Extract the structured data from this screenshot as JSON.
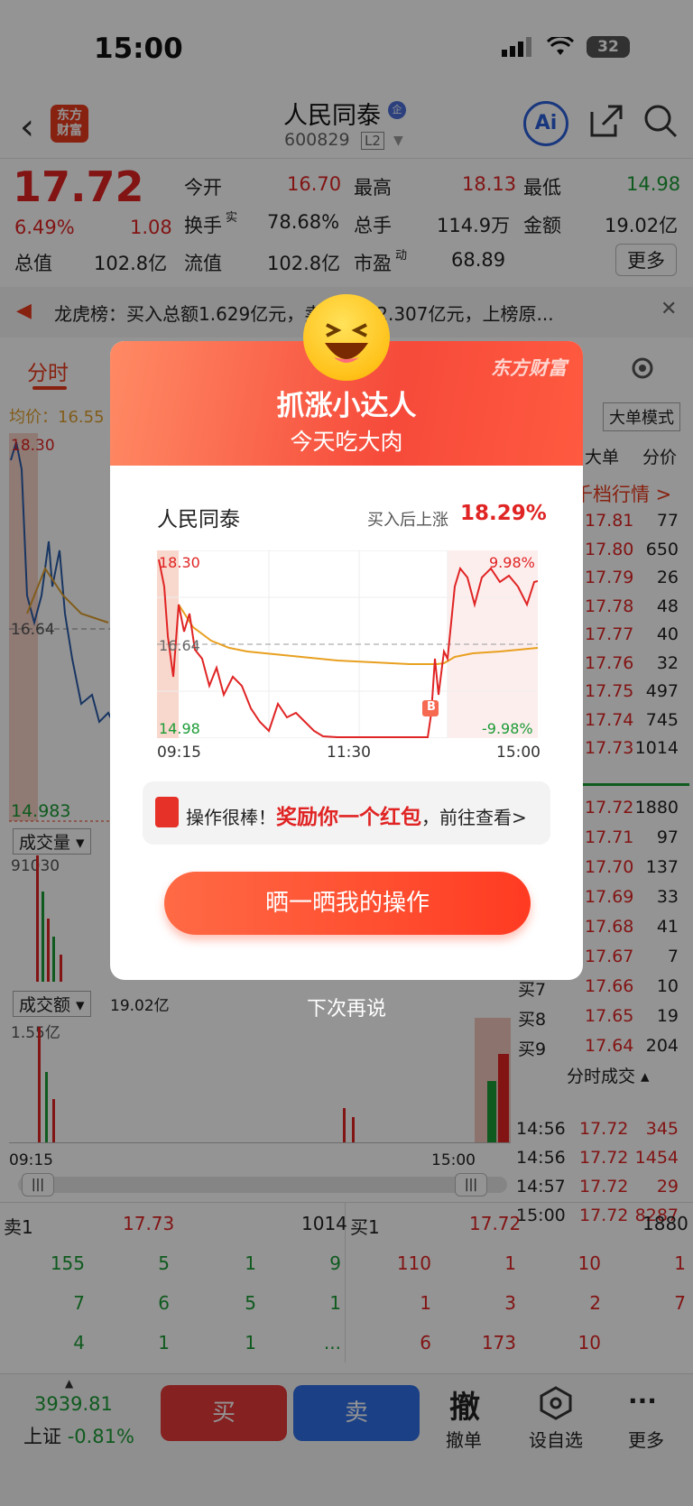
{
  "status": {
    "time": "15:00",
    "battery": "32"
  },
  "header": {
    "stock_name": "人民同泰",
    "badge": "企",
    "stock_code": "600829",
    "level": "L2",
    "logo_line1": "东方",
    "logo_line2": "财富",
    "ai_label": "Ai"
  },
  "quote": {
    "price": "17.72",
    "change_pct": "6.49%",
    "change": "1.08",
    "open_label": "今开",
    "open": "16.70",
    "high_label": "最高",
    "high": "18.13",
    "low_label": "最低",
    "low": "14.98",
    "turnover_label": "换手",
    "turnover_sup": "实",
    "turnover": "78.68%",
    "vol_label": "总手",
    "vol": "114.9万",
    "amount_label": "金额",
    "amount": "19.02亿",
    "mcap_label": "总值",
    "mcap": "102.8亿",
    "float_label": "流值",
    "float": "102.8亿",
    "pe_label": "市盈",
    "pe_sup": "动",
    "pe": "68.89",
    "more": "更多"
  },
  "news": {
    "text": "龙虎榜：买入总额1.629亿元，卖出总额2.307亿元，上榜原..."
  },
  "tabs": {
    "active": "分时",
    "mode": "大单模式"
  },
  "chart": {
    "avg_label": "均价：16.55",
    "high": "18.30",
    "mid": "16.64",
    "low": "14.983",
    "vol_selector": "成交量",
    "vol_max": "91030",
    "amt_selector": "成交额",
    "amt_total": "19.02亿",
    "amt_max": "1.55亿",
    "x_start": "09:15",
    "x_end": "15:00"
  },
  "right_col": {
    "h_big": "大单",
    "h_price": "分价",
    "title": "千档行情 >",
    "sells": [
      {
        "price": "17.81",
        "vol": "77"
      },
      {
        "price": "17.80",
        "vol": "650"
      },
      {
        "price": "17.79",
        "vol": "26"
      },
      {
        "price": "17.78",
        "vol": "48"
      },
      {
        "price": "17.77",
        "vol": "40"
      },
      {
        "price": "17.76",
        "vol": "32"
      },
      {
        "price": "17.75",
        "vol": "497"
      },
      {
        "price": "17.74",
        "vol": "745"
      },
      {
        "price": "17.73",
        "vol": "1014"
      }
    ],
    "buys": [
      {
        "label": "",
        "price": "17.72",
        "vol": "1880"
      },
      {
        "label": "",
        "price": "17.71",
        "vol": "97"
      },
      {
        "label": "",
        "price": "17.70",
        "vol": "137"
      },
      {
        "label": "",
        "price": "17.69",
        "vol": "33"
      },
      {
        "label": "",
        "price": "17.68",
        "vol": "41"
      },
      {
        "label": "",
        "price": "17.67",
        "vol": "7"
      },
      {
        "label": "买7",
        "price": "17.66",
        "vol": "10"
      },
      {
        "label": "买8",
        "price": "17.65",
        "vol": "19"
      },
      {
        "label": "买9",
        "price": "17.64",
        "vol": "204"
      }
    ],
    "ticks_title": "分时成交",
    "ticks": [
      {
        "time": "14:56",
        "price": "17.72",
        "vol": "345"
      },
      {
        "time": "14:56",
        "price": "17.72",
        "vol": "1454"
      },
      {
        "time": "14:57",
        "price": "17.72",
        "vol": "29"
      },
      {
        "time": "15:00",
        "price": "17.72",
        "vol": "8287"
      }
    ]
  },
  "bottom_book": {
    "sell1_label": "卖1",
    "sell1_price": "17.73",
    "sell1_vol": "1014",
    "buy1_label": "买1",
    "buy1_price": "17.72",
    "buy1_vol": "1880",
    "sell_rows": [
      [
        "155",
        "5",
        "1",
        "9"
      ],
      [
        "7",
        "6",
        "5",
        "1"
      ],
      [
        "4",
        "1",
        "1",
        "..."
      ]
    ],
    "buy_rows": [
      [
        "110",
        "1",
        "10",
        "1"
      ],
      [
        "1",
        "3",
        "2",
        "7"
      ],
      [
        "6",
        "173",
        "10",
        ""
      ]
    ]
  },
  "bottom_nav": {
    "index_value": "3939.81",
    "index_name": "上证",
    "index_change": "-0.81%",
    "buy": "买",
    "sell": "卖",
    "cancel_icon": "撤",
    "cancel": "撤单",
    "watch": "设自选",
    "more": "更多"
  },
  "modal": {
    "title": "抓涨小达人",
    "subtitle": "今天吃大肉",
    "brand": "东方财富",
    "stock": "人民同泰",
    "rise_label": "买入后上涨",
    "rise_value": "18.29%",
    "chart_high": "18.30",
    "chart_mid": "16.64",
    "chart_low": "14.98",
    "chart_up": "9.98%",
    "chart_down": "-9.98%",
    "buy_marker": "B",
    "x_labels": [
      "09:15",
      "11:30",
      "15:00"
    ],
    "packet_prefix": "操作很棒！",
    "packet_highlight": "奖励你一个红包",
    "packet_suffix": "，前往查看>",
    "share_button": "晒一晒我的操作",
    "later": "下次再说"
  },
  "chart_data": {
    "type": "line",
    "x_labels": [
      "09:15",
      "11:30",
      "15:00"
    ],
    "ylim": [
      14.98,
      18.3
    ],
    "series": [],
    "marker": "B"
  }
}
